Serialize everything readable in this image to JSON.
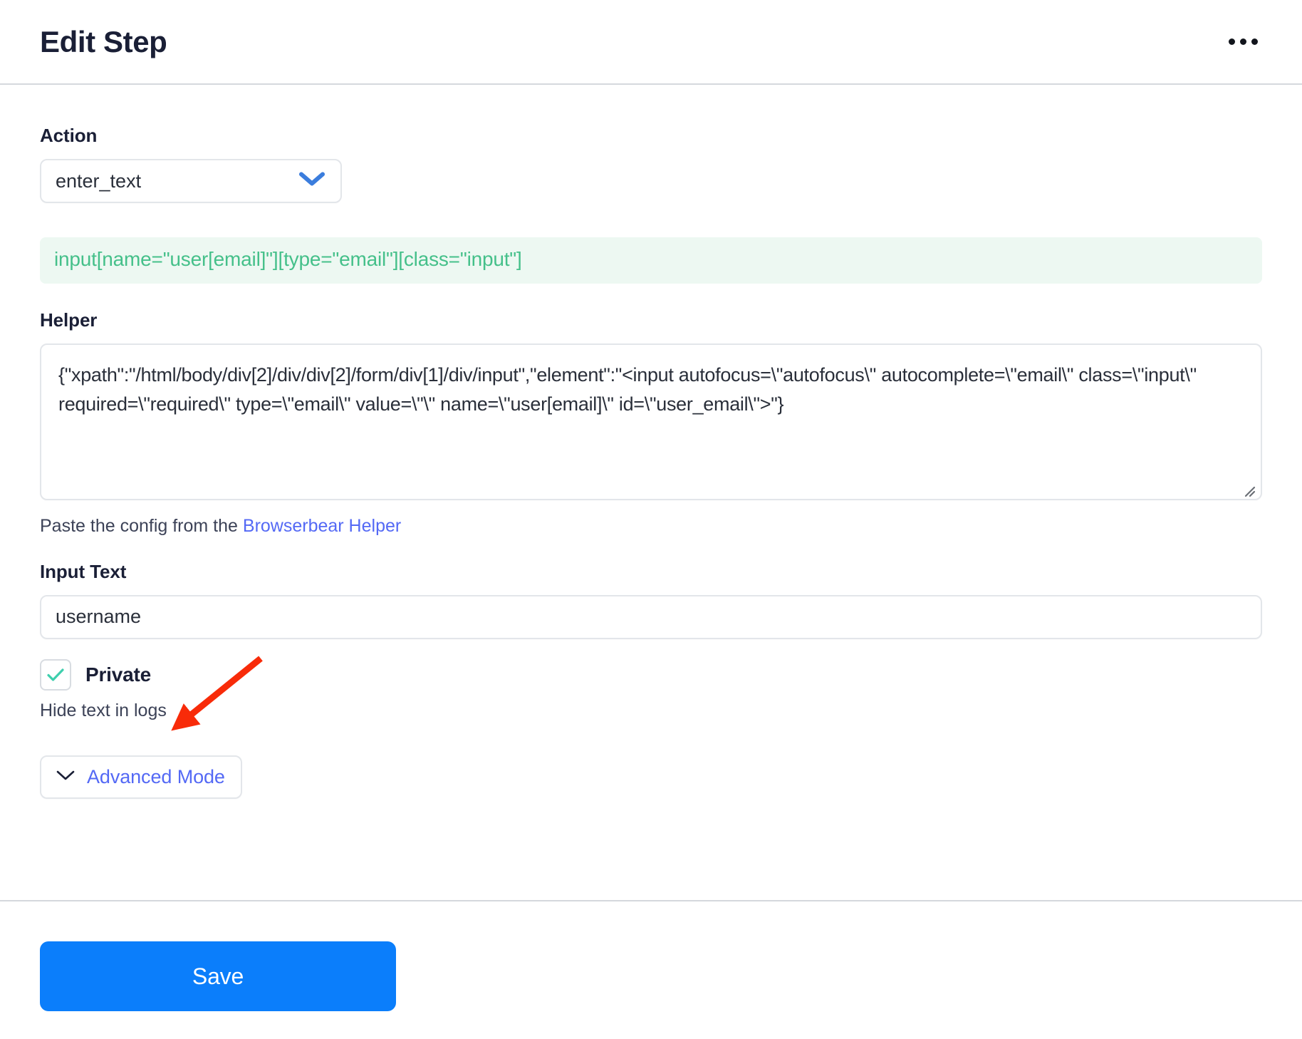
{
  "header": {
    "title": "Edit Step",
    "menu_icon": "kebab-menu-icon"
  },
  "form": {
    "action": {
      "label": "Action",
      "value": "enter_text",
      "options": [
        "enter_text"
      ],
      "chevron_icon": "chevron-down-icon",
      "chevron_color": "#3b7ddd"
    },
    "selector": {
      "value": "input[name=\"user[email]\"][type=\"email\"][class=\"input\"]",
      "text_color": "#45c08a",
      "background_color": "#edf8f2"
    },
    "helper": {
      "label": "Helper",
      "value": "{\"xpath\":\"/html/body/div[2]/div/div[2]/form/div[1]/div/input\",\"element\":\"<input autofocus=\\\"autofocus\\\" autocomplete=\\\"email\\\" class=\\\"input\\\" required=\\\"required\\\" type=\\\"email\\\" value=\\\"\\\" name=\\\"user[email]\\\" id=\\\"user_email\\\">\"}",
      "hint_prefix": "Paste the config from the ",
      "hint_link": "Browserbear Helper",
      "resize_handle_icon": "resize-grip-icon"
    },
    "input_text": {
      "label": "Input Text",
      "value": "username",
      "placeholder": ""
    },
    "private": {
      "label": "Private",
      "checked": true,
      "check_icon": "checkmark-icon",
      "check_color": "#3ecfad",
      "hint": "Hide text in logs"
    },
    "advanced_mode": {
      "label": "Advanced Mode",
      "chevron_icon": "chevron-down-icon",
      "link_color": "#5469f5"
    }
  },
  "footer": {
    "save_label": "Save",
    "save_color": "#0b7efb"
  },
  "annotation": {
    "arrow_color": "#f82b09",
    "arrow_name": "red-pointer-arrow"
  }
}
